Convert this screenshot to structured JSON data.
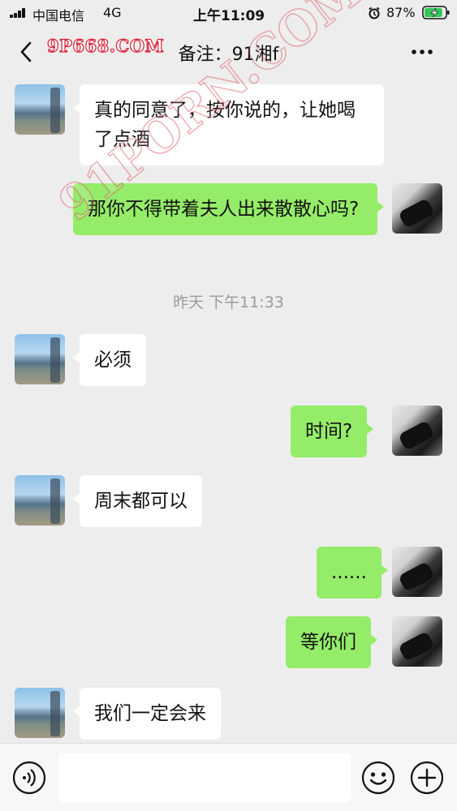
{
  "status_bar": {
    "carrier": "中国电信",
    "network": "4G",
    "time": "上午11:09",
    "battery_percent": "87%",
    "battery_level": 0.87
  },
  "header": {
    "title": "备注：91湘f",
    "watermark": "9P668.COM"
  },
  "watermark_large": "91PORN.COM",
  "messages": [
    {
      "side": "left",
      "text": "真的同意了，按你说的，让她喝了点酒"
    },
    {
      "side": "right",
      "text": "那你不得带着夫人出来散散心吗?"
    },
    {
      "side": "time",
      "text": "昨天 下午11:33"
    },
    {
      "side": "left",
      "text": "必须"
    },
    {
      "side": "right",
      "text": "时间?"
    },
    {
      "side": "left",
      "text": "周末都可以"
    },
    {
      "side": "right",
      "text": "......"
    },
    {
      "side": "right",
      "text": "等你们"
    },
    {
      "side": "left",
      "text": "我们一定会来"
    }
  ],
  "input_bar": {
    "placeholder": "",
    "icons": [
      "voice-icon",
      "emoji-icon",
      "plus-icon"
    ]
  },
  "colors": {
    "background": "#ededed",
    "bubble_self": "#95ec69",
    "bubble_other": "#ffffff",
    "timestamp": "#9a9a9a"
  }
}
